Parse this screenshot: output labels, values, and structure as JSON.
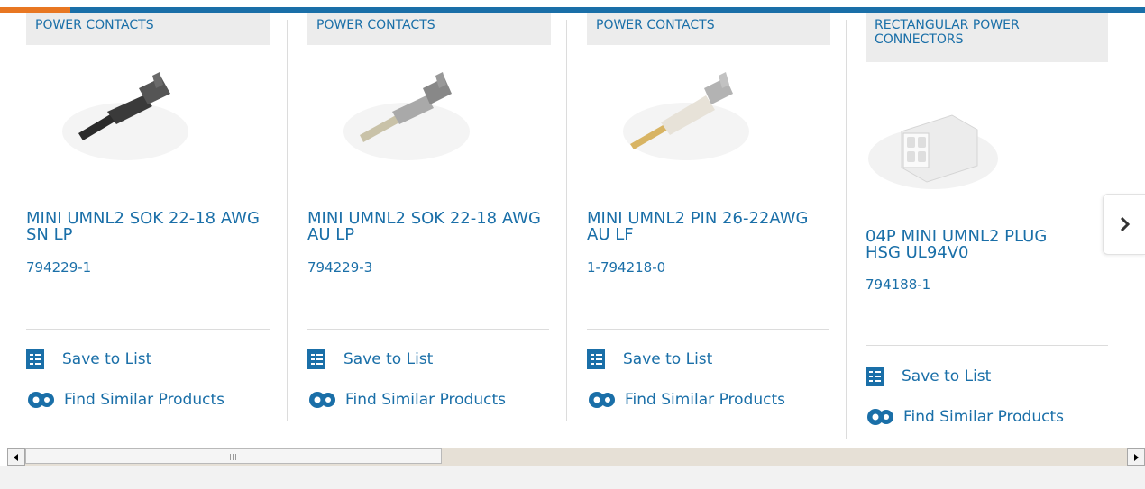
{
  "cards": [
    {
      "category": "POWER CONTACTS",
      "title": "MINI UMNL2 SOK 22-18 AWG SN LP",
      "part_number": "794229-1",
      "save_label": "Save to List",
      "similar_label": "Find Similar Products",
      "image_icon": "crimp-socket-contact-tin"
    },
    {
      "category": "POWER CONTACTS",
      "title": "MINI UMNL2 SOK 22-18 AWG AU LP",
      "part_number": "794229-3",
      "save_label": "Save to List",
      "similar_label": "Find Similar Products",
      "image_icon": "crimp-socket-contact-gold"
    },
    {
      "category": "POWER CONTACTS",
      "title": "MINI UMNL2 PIN 26-22AWG AU LF",
      "part_number": "1-794218-0",
      "save_label": "Save to List",
      "similar_label": "Find Similar Products",
      "image_icon": "crimp-pin-contact-gold"
    },
    {
      "category": "RECTANGULAR POWER CONNECTORS",
      "title": "04P MINI UMNL2 PLUG HSG UL94V0",
      "part_number": "794188-1",
      "save_label": "Save to List",
      "similar_label": "Find Similar Products",
      "image_icon": "plug-housing-white"
    }
  ],
  "colors": {
    "brand": "#1a6fa8",
    "accent": "#e87722"
  },
  "carousel": {
    "next_icon": "chevron-right-icon"
  },
  "scrollbar": {
    "left_icon": "arrow-left-icon",
    "right_icon": "arrow-right-icon"
  }
}
